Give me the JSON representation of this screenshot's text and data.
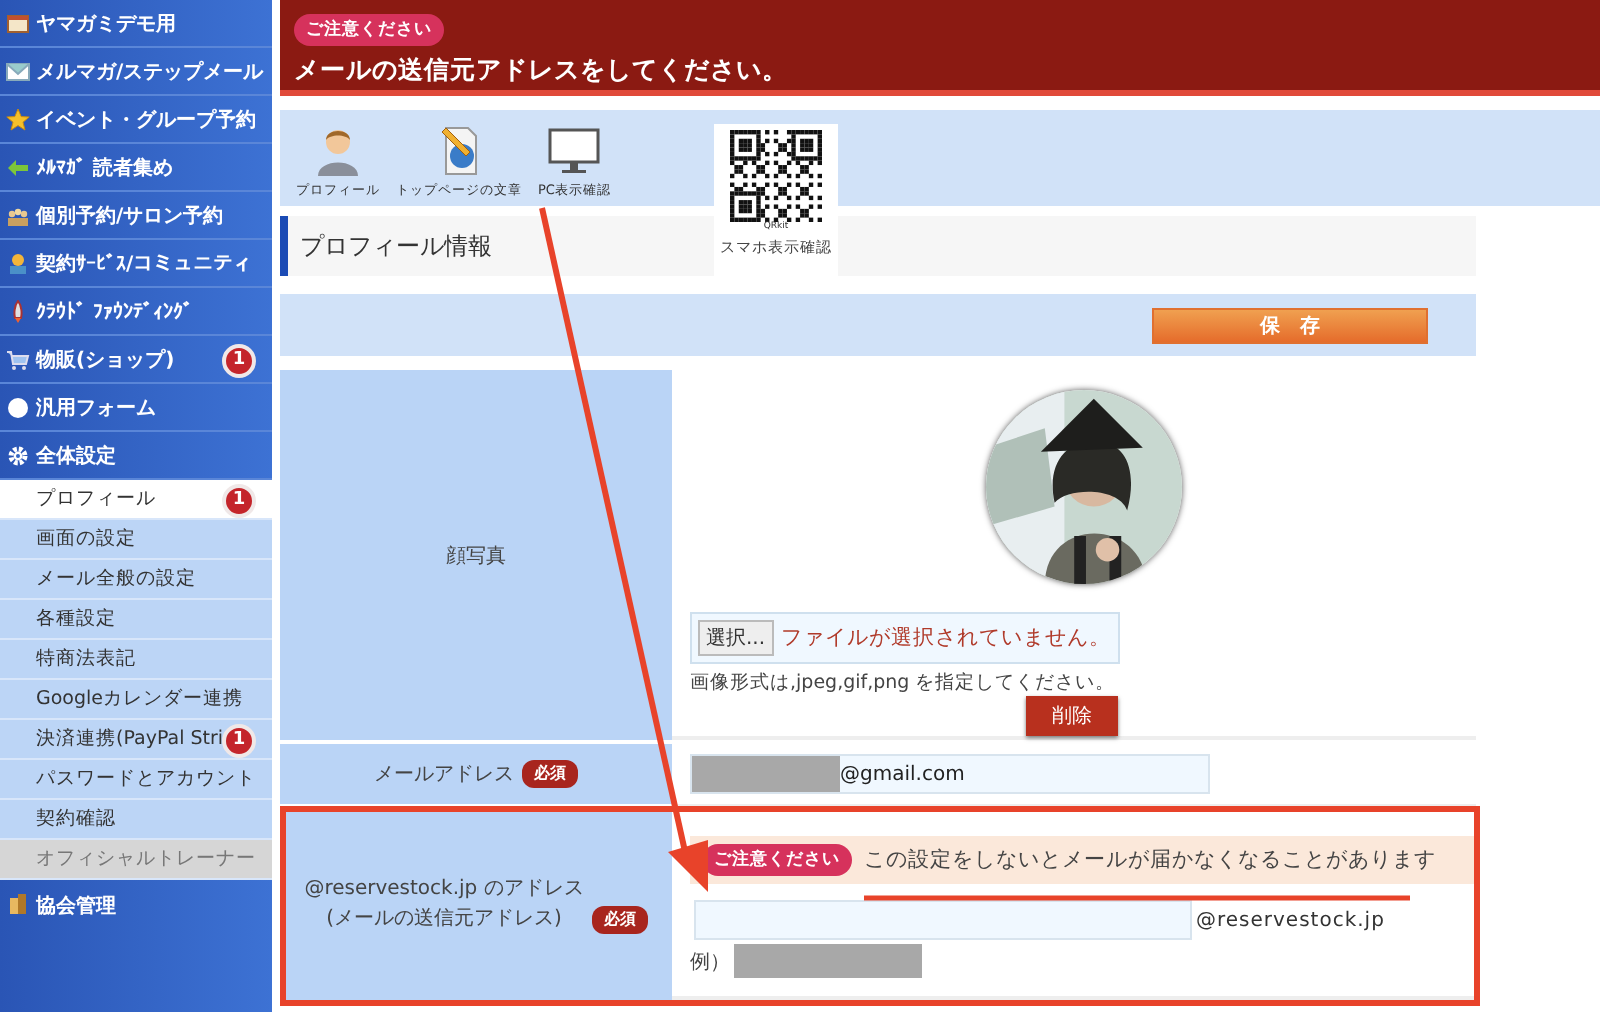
{
  "sidebar": {
    "items": [
      {
        "label": "ヤマガミデモ用"
      },
      {
        "label": "メルマガ/ステップメール"
      },
      {
        "label": "イベント・グループ予約"
      },
      {
        "label": "ﾒﾙﾏｶﾞ 読者集め"
      },
      {
        "label": "個別予約/サロン予約"
      },
      {
        "label": "契約ｻｰﾋﾞｽ/コミュニティ"
      },
      {
        "label": "ｸﾗｳﾄﾞ ﾌｧｳﾝﾃﾞｨﾝｸﾞ"
      },
      {
        "label": "物販(ショップ)",
        "badge": "1"
      },
      {
        "label": "汎用フォーム"
      },
      {
        "label": "全体設定",
        "children": [
          {
            "label": "プロフィール",
            "selected": true,
            "disabled": false,
            "badge": "1"
          },
          {
            "label": "画面の設定",
            "selected": false,
            "disabled": false
          },
          {
            "label": "メール全般の設定",
            "selected": false,
            "disabled": false
          },
          {
            "label": "各種設定",
            "selected": false,
            "disabled": false
          },
          {
            "label": "特商法表記",
            "selected": false,
            "disabled": false
          },
          {
            "label": "Googleカレンダー連携",
            "selected": false,
            "disabled": false
          },
          {
            "label": "決済連携(PayPal Stri",
            "selected": false,
            "disabled": false,
            "badge": "1"
          },
          {
            "label": "パスワードとアカウント",
            "selected": false,
            "disabled": false
          },
          {
            "label": "契約確認",
            "selected": false,
            "disabled": false
          },
          {
            "label": "オフィシャルトレーナー",
            "selected": false,
            "disabled": true
          }
        ]
      },
      {
        "label": "協会管理"
      }
    ]
  },
  "alert": {
    "badge": "ご注意ください",
    "message": "メールの送信元アドレスをしてください。"
  },
  "toolbar": {
    "items": [
      {
        "label": "プロフィール"
      },
      {
        "label": "トップページの文章"
      },
      {
        "label": "PC表示確認"
      }
    ],
    "qr": {
      "mark": "QRkit",
      "label": "スマホ表示確認"
    }
  },
  "section_title": "プロフィール情報",
  "save_button": "保　存",
  "form": {
    "rows": [
      {
        "label": "顔写真",
        "file_button": "選択...",
        "file_status": "ファイルが選択されていません。",
        "hint": "画像形式は,jpeg,gif,png を指定してください。",
        "delete_button": "削除"
      },
      {
        "kind": "email",
        "label": "メールアドレス",
        "required": "必須",
        "value": "@gmail.com"
      },
      {
        "kind": "sender",
        "label": "@reservestock.jp のアドレス(メールの送信元アドレス)",
        "required": "必須",
        "notice_badge": "ご注意ください",
        "notice": "この設定をしないとメールが届かなくなることがあります",
        "domain": "@reservestock.jp",
        "example": "例）"
      }
    ]
  }
}
